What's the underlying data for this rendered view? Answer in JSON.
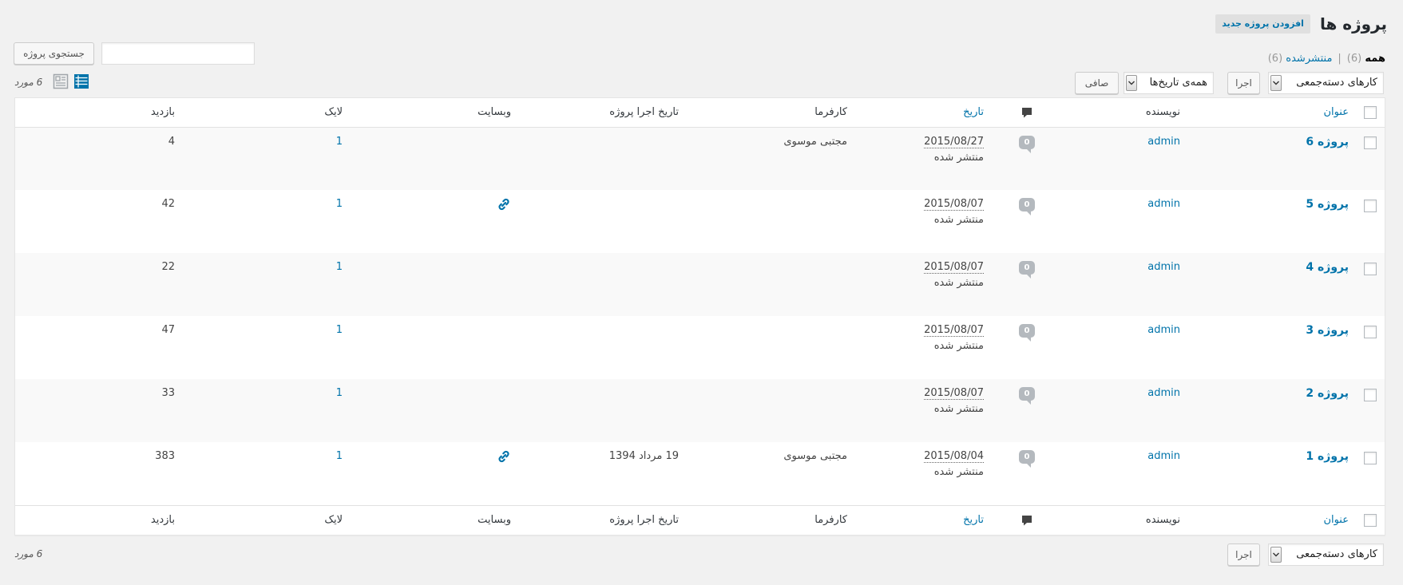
{
  "page": {
    "title": "پروژه ها",
    "add_new_label": "افزودن پروژه جدید"
  },
  "views": {
    "all": {
      "label": "همه",
      "count": "(6)"
    },
    "separator": "|",
    "published": {
      "label": "منتشرشده",
      "count": "(6)"
    }
  },
  "search": {
    "value": "",
    "button_label": "جستجوی پروژه"
  },
  "tablenav_top": {
    "bulk_actions": "کارهای دسته‌جمعی",
    "apply_label": "اجرا",
    "date_filter": "همه‌ی تاریخ‌ها",
    "filter_label": "صافی",
    "items_count": "6 مورد"
  },
  "tablenav_bottom": {
    "bulk_actions": "کارهای دسته‌جمعی",
    "apply_label": "اجرا",
    "items_count": "6 مورد"
  },
  "columns": {
    "title": "عنوان",
    "author": "نویسنده",
    "date": "تاریخ",
    "client": "کارفرما",
    "execution_date": "تاریخ اجرا پروژه",
    "website": "وبسایت",
    "likes": "لایک",
    "views": "بازدید"
  },
  "rows": [
    {
      "title": "پروژه 6",
      "author": "admin",
      "comments": "0",
      "date": "2015/08/27",
      "status": "منتشر شده",
      "client": "مجتبی موسوی",
      "execution_date": "",
      "has_website": false,
      "likes": "1",
      "views": "4"
    },
    {
      "title": "پروژه 5",
      "author": "admin",
      "comments": "0",
      "date": "2015/08/07",
      "status": "منتشر شده",
      "client": "",
      "execution_date": "",
      "has_website": true,
      "likes": "1",
      "views": "42"
    },
    {
      "title": "پروژه 4",
      "author": "admin",
      "comments": "0",
      "date": "2015/08/07",
      "status": "منتشر شده",
      "client": "",
      "execution_date": "",
      "has_website": false,
      "likes": "1",
      "views": "22"
    },
    {
      "title": "پروژه 3",
      "author": "admin",
      "comments": "0",
      "date": "2015/08/07",
      "status": "منتشر شده",
      "client": "",
      "execution_date": "",
      "has_website": false,
      "likes": "1",
      "views": "47"
    },
    {
      "title": "پروژه 2",
      "author": "admin",
      "comments": "0",
      "date": "2015/08/07",
      "status": "منتشر شده",
      "client": "",
      "execution_date": "",
      "has_website": false,
      "likes": "1",
      "views": "33"
    },
    {
      "title": "پروژه 1",
      "author": "admin",
      "comments": "0",
      "date": "2015/08/04",
      "status": "منتشر شده",
      "client": "مجتبی موسوی",
      "execution_date": "19 مرداد 1394",
      "has_website": true,
      "likes": "1",
      "views": "383"
    }
  ],
  "icons": {
    "comments_column": "comment-icon",
    "comment_count": "comment-bubble-icon",
    "website": "link-icon",
    "select_arrow": "chevron-down-icon",
    "view_mode_active": "list-view-icon",
    "view_mode_inactive": "excerpt-view-icon"
  },
  "colors": {
    "link": "#0073aa",
    "text": "#32373c",
    "background": "#f1f1f1",
    "row_stripe": "#f9f9f9",
    "comment_bubble": "#b4b9be"
  }
}
